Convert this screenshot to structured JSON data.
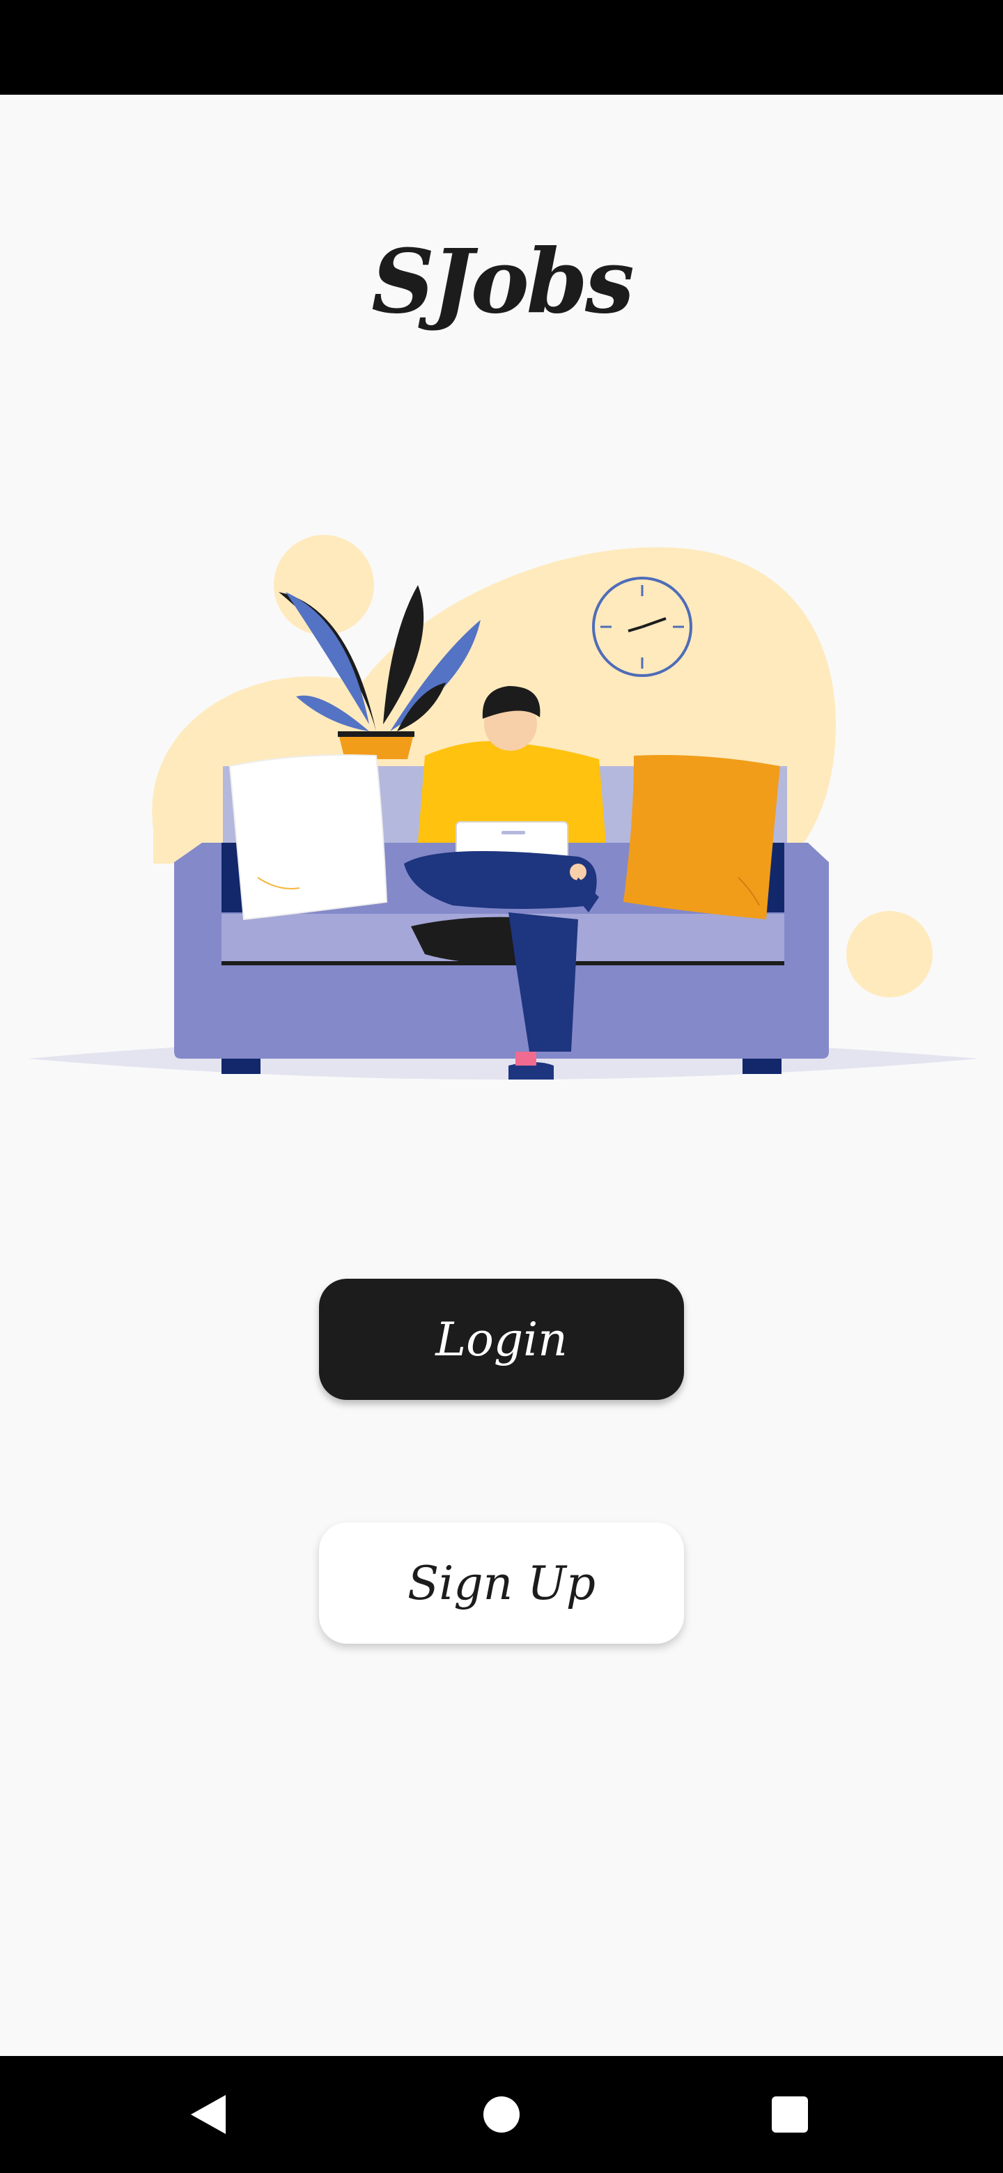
{
  "app": {
    "title": "SJobs"
  },
  "actions": {
    "login_label": "Login",
    "signup_label": "Sign Up"
  },
  "illustration": {
    "subject": "person-on-sofa-with-laptop"
  },
  "system_nav": {
    "back_icon": "back-icon",
    "home_icon": "home-icon",
    "recents_icon": "recents-icon"
  },
  "colors": {
    "background": "#f9f9f9",
    "primary_button": "#1c1c1c",
    "secondary_button": "#ffffff",
    "sofa": "#8489c9",
    "blob": "#ffeabd",
    "shirt": "#ffc20e",
    "pillow_orange": "#f19d1a"
  }
}
